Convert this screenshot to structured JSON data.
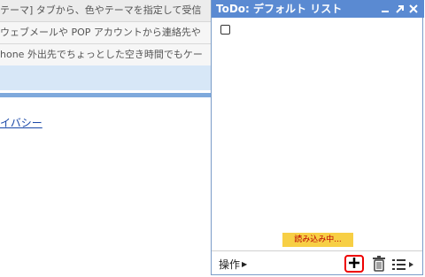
{
  "background": {
    "rows": [
      "テーマ] タブから、色やテーマを指定して受信",
      "ウェブメールや POP アカウントから連絡先や",
      "hone 外出先でちょっとした空き時間でもケー"
    ],
    "link": "イバシー"
  },
  "todo": {
    "title": "ToDo: デフォルト リスト",
    "loading": "読み込み中...",
    "actions_label": "操作"
  },
  "colors": {
    "titlebar": "#5a8ad2",
    "loading_bg": "#f7cf45",
    "highlight": "#e00000"
  },
  "icons": {
    "minimize": "minimize-icon",
    "popout": "popout-icon",
    "close": "close-icon",
    "add": "plus-icon",
    "delete": "trash-icon",
    "lists": "list-menu-icon"
  }
}
